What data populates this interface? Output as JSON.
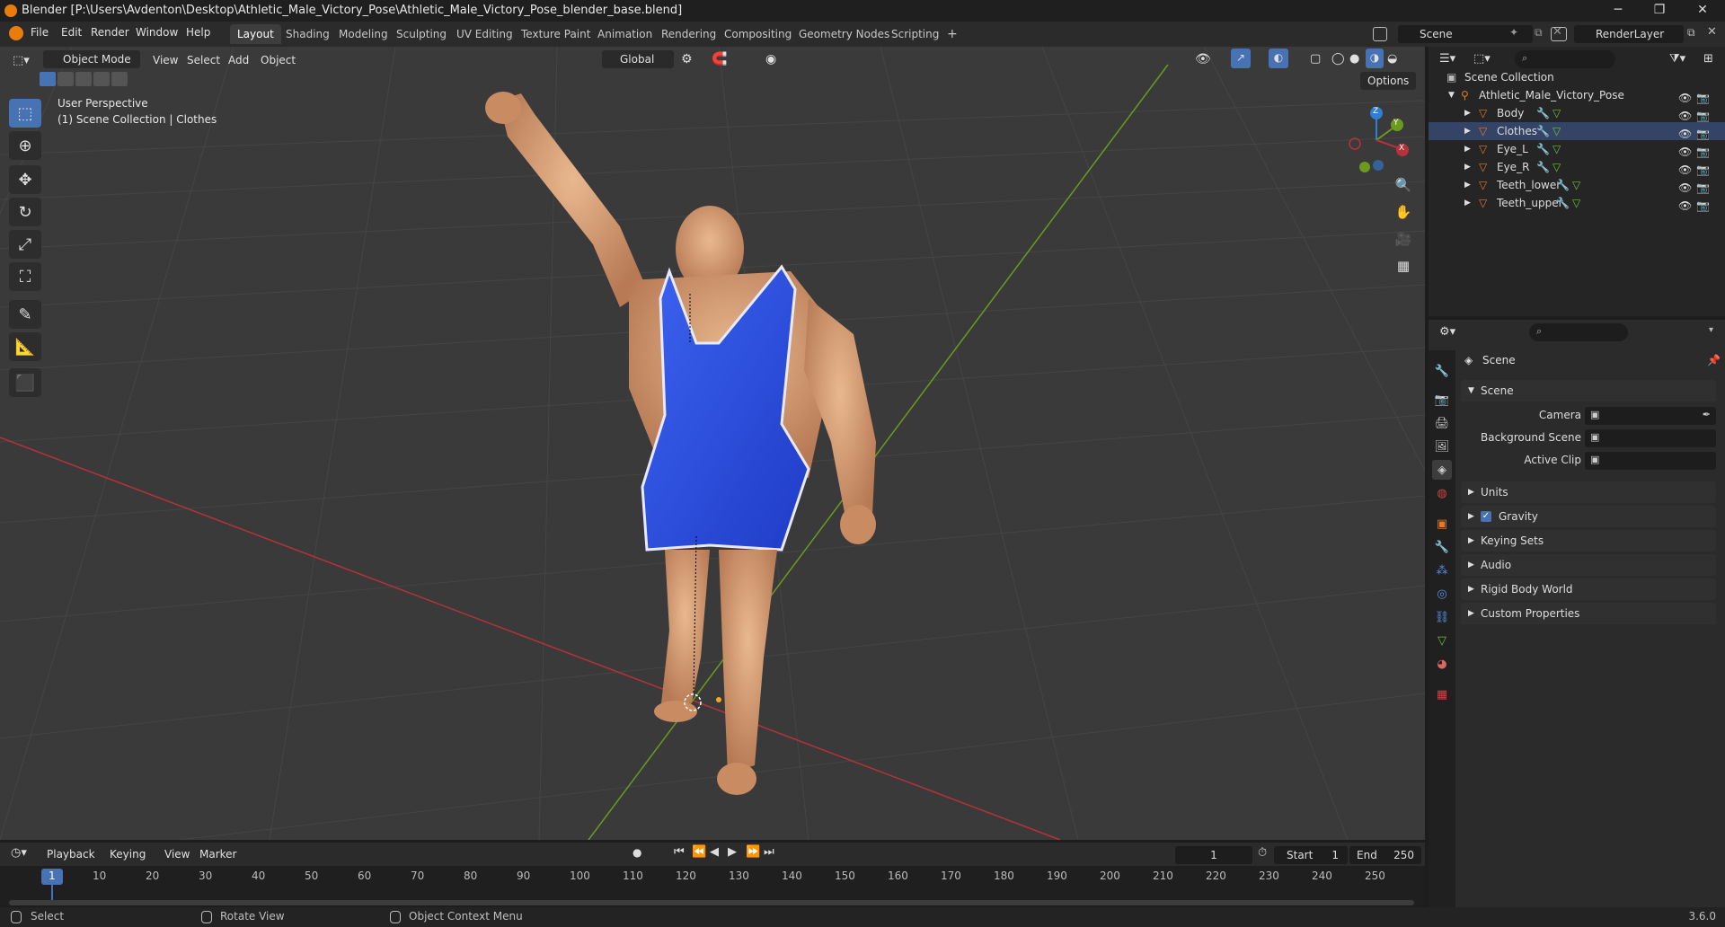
{
  "window": {
    "title": "Blender [P:\\Users\\Avdenton\\Desktop\\Athletic_Male_Victory_Pose\\Athletic_Male_Victory_Pose_blender_base.blend]",
    "minimize": "─",
    "maximize": "❐",
    "close": "✕"
  },
  "menu": [
    "File",
    "Edit",
    "Render",
    "Window",
    "Help"
  ],
  "workspaces": [
    "Layout",
    "Shading",
    "Modeling",
    "Sculpting",
    "UV Editing",
    "Texture Paint",
    "Animation",
    "Rendering",
    "Compositing",
    "Geometry Nodes",
    "Scripting"
  ],
  "workspace_add": "+",
  "scene_field": "Scene",
  "renderlayer_field": "RenderLayer",
  "viewport": {
    "mode": "Object Mode",
    "menus": [
      "View",
      "Select",
      "Add",
      "Object"
    ],
    "transform_orientation": "Global",
    "options_label": "Options",
    "overlay_line1": "User Perspective",
    "overlay_line2": "(1) Scene Collection | Clothes",
    "gizmo": {
      "z": "Z",
      "y": "Y",
      "x": "X"
    }
  },
  "outliner": {
    "root": "Scene Collection",
    "collection": "Athletic_Male_Victory_Pose",
    "objects": [
      "Body",
      "Clothes",
      "Eye_L",
      "Eye_R",
      "Teeth_lower",
      "Teeth_upper"
    ]
  },
  "properties": {
    "header": "Scene",
    "panel_scene": "Scene",
    "rows": [
      {
        "label": "Camera"
      },
      {
        "label": "Background Scene"
      },
      {
        "label": "Active Clip"
      }
    ],
    "panels": [
      "Units",
      "Gravity",
      "Keying Sets",
      "Audio",
      "Rigid Body World",
      "Custom Properties"
    ]
  },
  "timeline": {
    "menus": [
      "Playback",
      "Keying",
      "View",
      "Marker"
    ],
    "current_frame": "1",
    "start_label": "Start",
    "start_value": "1",
    "end_label": "End",
    "end_value": "250",
    "ticks": [
      "1",
      "10",
      "20",
      "30",
      "40",
      "50",
      "60",
      "70",
      "80",
      "90",
      "100",
      "110",
      "120",
      "130",
      "140",
      "150",
      "160",
      "170",
      "180",
      "190",
      "200",
      "210",
      "220",
      "230",
      "240",
      "250"
    ]
  },
  "statusbar": {
    "select": "Select",
    "rotate": "Rotate View",
    "context": "Object Context Menu",
    "version": "3.6.0"
  },
  "colors": {
    "accent": "#4772b3",
    "mesh_icon": "#e07a2c",
    "xaxis": "#b5323c",
    "yaxis": "#6b9a1f",
    "zaxis": "#2f7fd6"
  }
}
